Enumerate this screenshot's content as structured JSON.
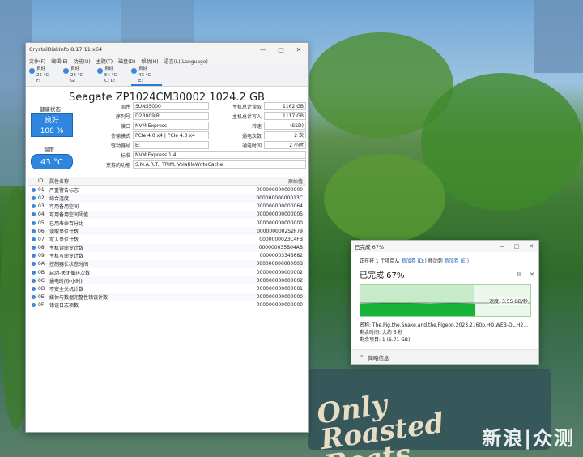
{
  "desktop": {
    "watermark": "新浪|众测",
    "mural_text": "Only Roasted Beats"
  },
  "cdi": {
    "title": "CrystalDiskInfo 8.17.11 x64",
    "window_controls": [
      "—",
      "□",
      "✕"
    ],
    "menu": [
      "文件(F)",
      "编辑(E)",
      "功能(U)",
      "主题(T)",
      "磁盘(D)",
      "帮助(H)",
      "语言(L)(Language)"
    ],
    "drives": [
      {
        "status": "良好",
        "temp": "25 °C",
        "letter": "F:"
      },
      {
        "status": "良好",
        "temp": "26 °C",
        "letter": "G:"
      },
      {
        "status": "良好",
        "temp": "54 °C",
        "letter": "C: D:"
      },
      {
        "status": "良好",
        "temp": "43 °C",
        "letter": "E:"
      }
    ],
    "model": "Seagate ZP1024CM30002 1024.2 GB",
    "health_label": "健康状态",
    "health_status": "良好",
    "health_percent": "100 %",
    "temp_label": "温度",
    "temp_value": "43 °C",
    "left_info": [
      {
        "label": "固件",
        "value": "SUNSS000"
      },
      {
        "label": "序列号",
        "value": "D2R009JR"
      },
      {
        "label": "接口",
        "value": "NVM Express"
      },
      {
        "label": "传输模式",
        "value": "PCIe 4.0 x4 | PCIe 4.0 x4"
      },
      {
        "label": "驱动器号",
        "value": "E:"
      }
    ],
    "right_info": [
      {
        "label": "主机总计读取",
        "value": "1162 GB"
      },
      {
        "label": "主机总计写入",
        "value": "1117 GB"
      },
      {
        "label": "转速",
        "value": "---- (SSD)"
      },
      {
        "label": "通电次数",
        "value": "2 次"
      },
      {
        "label": "通电时间",
        "value": "2 小时"
      }
    ],
    "standard_label": "标准",
    "standard_value": "NVM Express 1.4",
    "features_label": "支持的功能",
    "features_value": "S.M.A.R.T., TRIM, VolatileWriteCache",
    "smart_headers": {
      "id": "ID",
      "name": "属性名称",
      "raw": "原始值"
    },
    "smart_rows": [
      {
        "id": "01",
        "name": "严重警告标志",
        "raw": "000000000000000"
      },
      {
        "id": "02",
        "name": "综合温度",
        "raw": "00000000000013C"
      },
      {
        "id": "03",
        "name": "可用备用空间",
        "raw": "000000000000064"
      },
      {
        "id": "04",
        "name": "可用备用空间阈值",
        "raw": "000000000000005"
      },
      {
        "id": "05",
        "name": "已用寿命百分比",
        "raw": "000000000000000"
      },
      {
        "id": "06",
        "name": "读取单位计数",
        "raw": "0000000002S2F79"
      },
      {
        "id": "07",
        "name": "写入单位计数",
        "raw": "0000000023C4FB"
      },
      {
        "id": "08",
        "name": "主机读命令计数",
        "raw": "000000035B04AB"
      },
      {
        "id": "09",
        "name": "主机写命令计数",
        "raw": "0000000334S682"
      },
      {
        "id": "0A",
        "name": "控制器忙状态时间",
        "raw": "00000000000000B"
      },
      {
        "id": "0B",
        "name": "启动-关闭循环次数",
        "raw": "000000000000002"
      },
      {
        "id": "0C",
        "name": "通电时间(小时)",
        "raw": "000000000000002"
      },
      {
        "id": "0D",
        "name": "不安全关机计数",
        "raw": "000000000000001"
      },
      {
        "id": "0E",
        "name": "媒体与数据完整性错误计数",
        "raw": "000000000000000"
      },
      {
        "id": "0F",
        "name": "错误日志项数",
        "raw": "000000000000000"
      }
    ]
  },
  "copy": {
    "title": "已完成 67%",
    "window_controls": [
      "—",
      "□",
      "✕"
    ],
    "line1_prefix": "正在将 1 个项目从",
    "from": "新加卷 (D:)",
    "line1_mid": "移动到",
    "to": "新加卷 (E:)",
    "progress_text": "已完成 67%",
    "progress": 0.67,
    "pause": "II",
    "close": "✕",
    "speed": "速度: 3.55 GB/秒",
    "name_line": "名称: The.Pig.the.Snake.and.the.Pigeon.2023.2160p.HQ.WEB-DL.H2...",
    "time_line": "剩余时间: 大约 5 秒",
    "items_line": "剩余项目: 1 (6.71 GB)",
    "details": "简略信息",
    "colors": {
      "fill": "#17b238",
      "graph_bg": "#c7ebc8"
    }
  }
}
